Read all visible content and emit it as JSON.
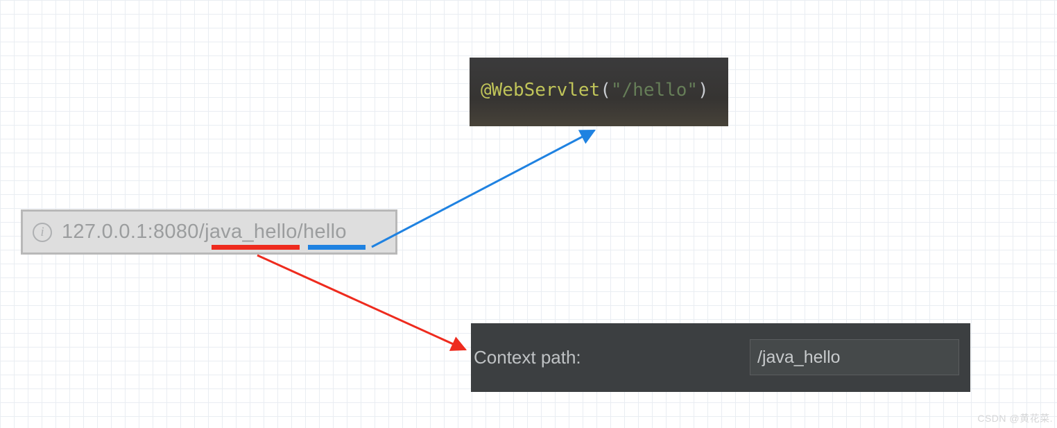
{
  "url_bar": {
    "full_url": "127.0.0.1:8080/java_hello/hello",
    "red_underlined_segment": "java_hello",
    "blue_underlined_segment": "hello"
  },
  "code_snippet": {
    "annotation_at": "@",
    "annotation_name": "WebServlet",
    "open_paren": "(",
    "string_literal": "\"/hello\"",
    "close_paren": ")"
  },
  "context_panel": {
    "label": "Context path:",
    "value": "/java_hello"
  },
  "arrows": {
    "blue": {
      "from_description": "blue underline under 'hello' in URL",
      "to_description": "@WebServlet code box",
      "color": "#1f82e1"
    },
    "red": {
      "from_description": "red underline under 'java_hello' in URL",
      "to_description": "Context path box",
      "color": "#ee2b1e"
    }
  },
  "watermark": "CSDN @黄花菜."
}
